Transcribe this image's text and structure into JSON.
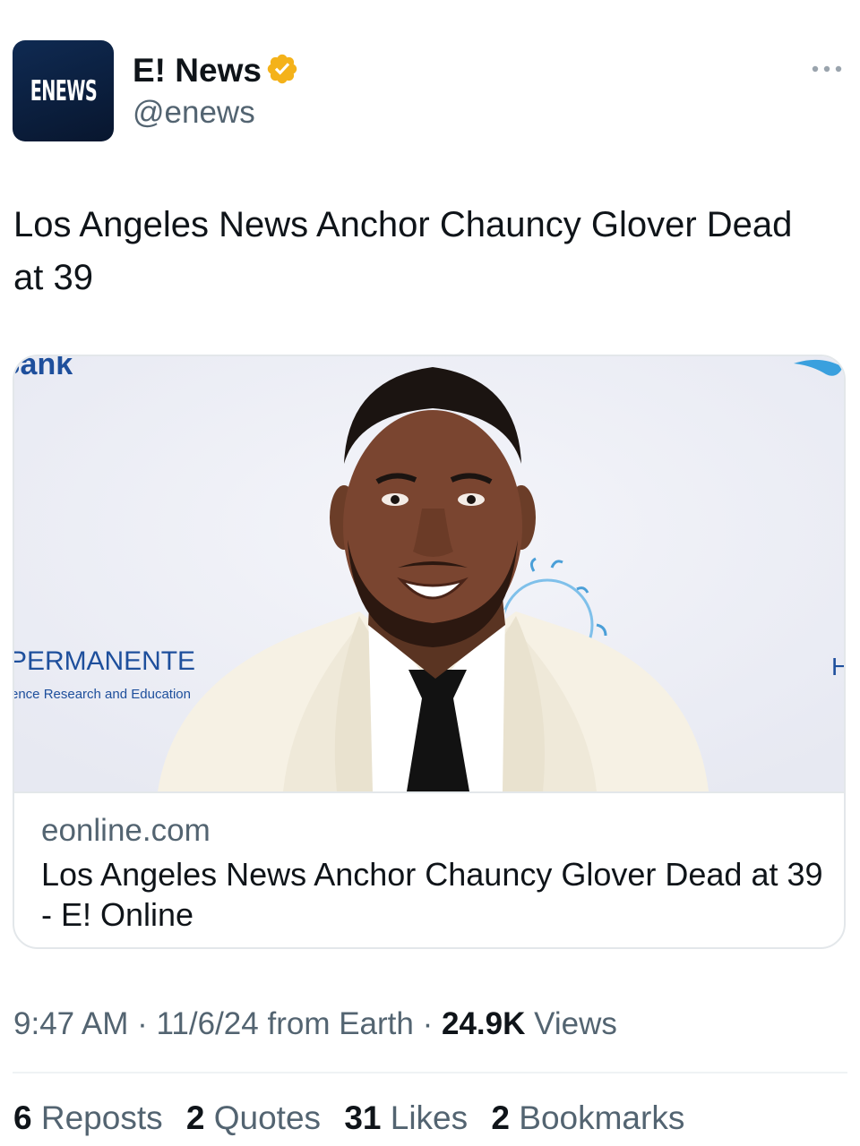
{
  "author": {
    "avatar_text": "ENEWS",
    "display_name": "E! News",
    "handle": "@enews",
    "verified_color": "#F4B21A"
  },
  "tweet": {
    "text": "Los Angeles News Anchor Chauncy Glover Dead at 39"
  },
  "card": {
    "backdrop_texts": {
      "top_left": "Bank",
      "sponsor": "PERMANENTE",
      "sponsor_sub": "ence Research and Education",
      "right_edge": "H"
    },
    "domain": "eonline.com",
    "title": "Los Angeles News Anchor Chauncy Glover Dead at 39 - E! Online"
  },
  "meta": {
    "time": "9:47 AM",
    "date": "11/6/24",
    "source": "from Earth",
    "views_count": "24.9K",
    "views_label": "Views"
  },
  "stats": [
    {
      "count": "6",
      "label": "Reposts"
    },
    {
      "count": "2",
      "label": "Quotes"
    },
    {
      "count": "31",
      "label": "Likes"
    },
    {
      "count": "2",
      "label": "Bookmarks"
    }
  ],
  "icons": {
    "verified": "verified-badge-icon",
    "more": "more-options-icon"
  }
}
